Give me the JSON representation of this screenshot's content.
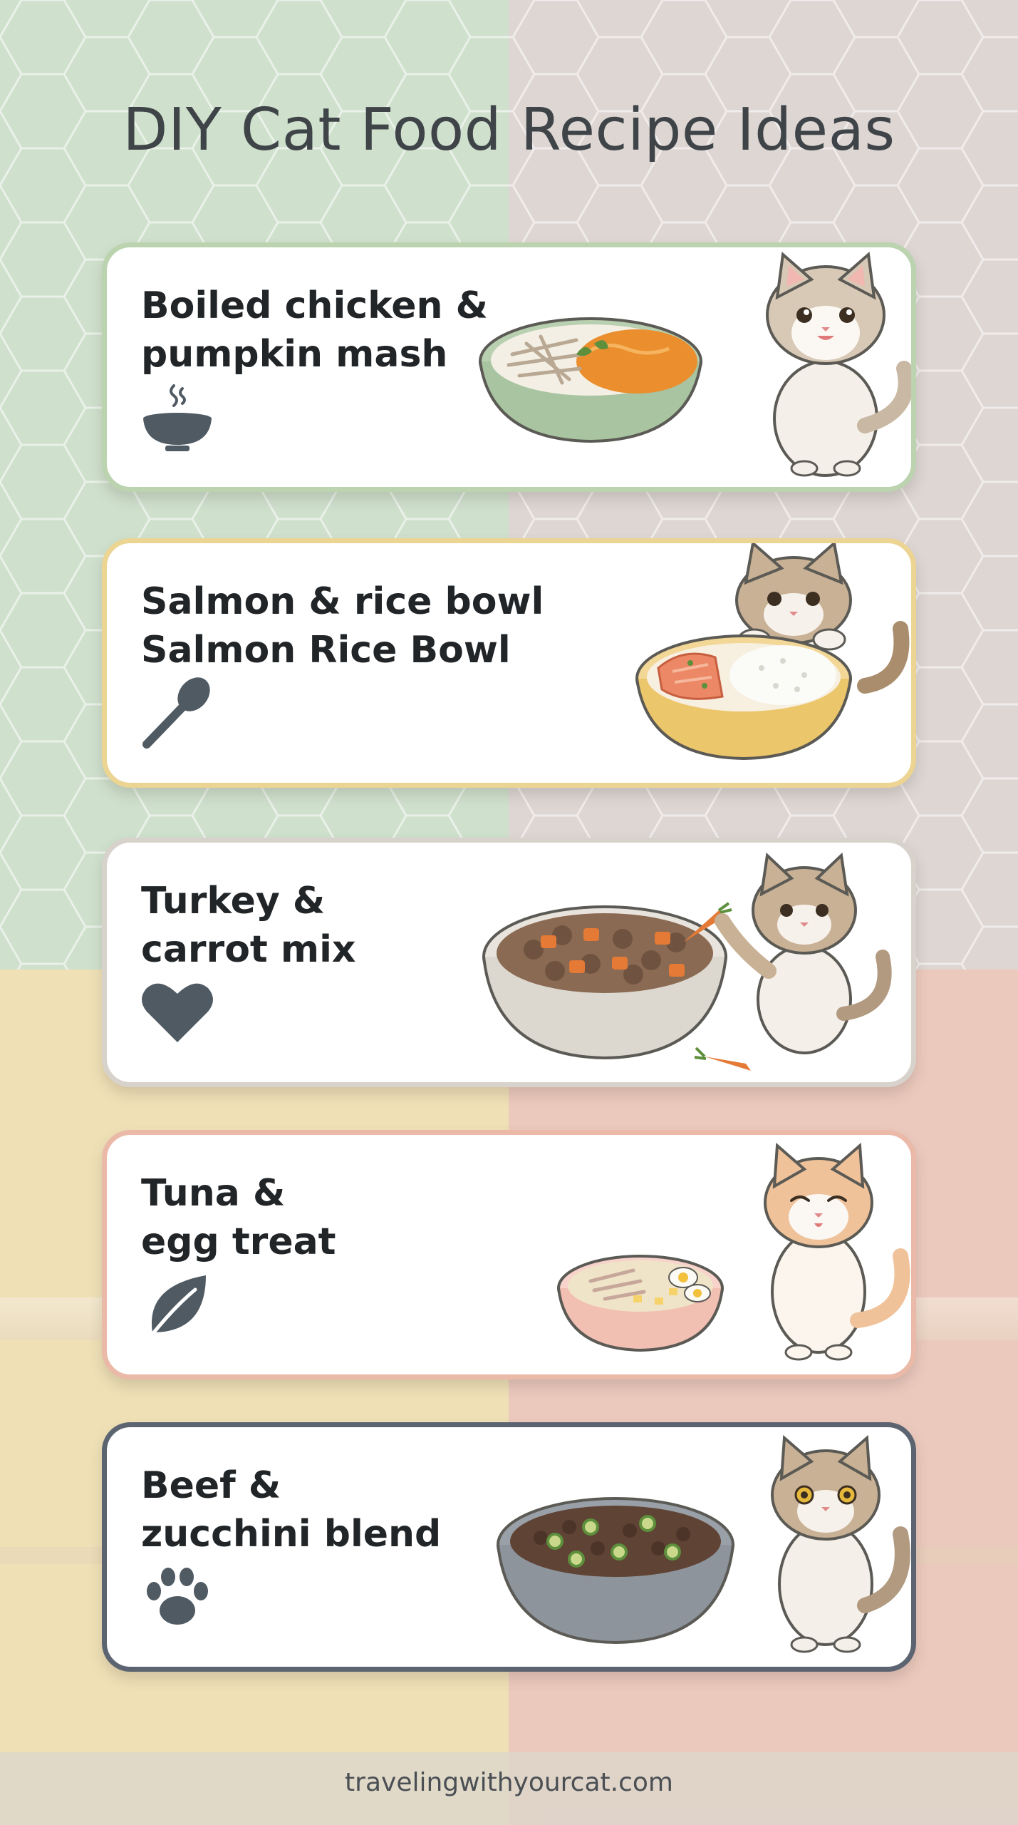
{
  "title": "DIY Cat Food Recipe Ideas",
  "cards": [
    {
      "line1": "Boiled chicken &",
      "line2": "pumpkin mash",
      "icon": "bowl-icon",
      "border": "#bcd3b0"
    },
    {
      "line1": "Salmon & rice bowl",
      "line2": "Salmon Rice Bowl",
      "icon": "spoon-icon",
      "border": "#ecd492"
    },
    {
      "line1": "Turkey &",
      "line2": "carrot mix",
      "icon": "heart-icon",
      "border": "#d8d2cc"
    },
    {
      "line1": "Tuna &",
      "line2": "egg treat",
      "icon": "leaf-icon",
      "border": "#eab9a8"
    },
    {
      "line1": "Beef &",
      "line2": "zucchini blend",
      "icon": "paw-icon",
      "border": "#5b6470"
    }
  ],
  "footer": {
    "url": "travelingwithyourcat.com"
  },
  "colors": {
    "icon": "#505a63",
    "title": "#3f4448"
  }
}
